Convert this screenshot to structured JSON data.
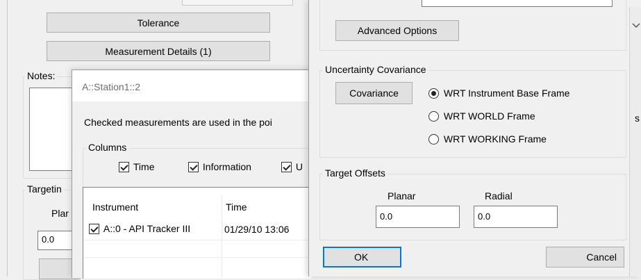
{
  "bg_panel": {
    "tolerance_label": "Tolerance",
    "measurement_details_label": "Measurement Details (1)",
    "notes_label": "Notes:",
    "targeting_label": "Targetin",
    "planar_label": "Plar",
    "planar_value": "0.0"
  },
  "mid_dialog": {
    "title": "A::Station1::2",
    "description": "Checked measurements are used in the poi",
    "columns_label": "Columns",
    "col_time": "Time",
    "col_information": "Information",
    "col_u": "U",
    "table_headers": [
      "Instrument",
      "Time"
    ],
    "rows": [
      {
        "instrument": "A::0 - API Tracker III",
        "time": "01/29/10 13:06",
        "checked": true
      }
    ]
  },
  "right_dialog": {
    "advanced_options_label": "Advanced Options",
    "uncertainty_label": "Uncertainty Covariance",
    "covariance_button": "Covariance",
    "radio_options": [
      {
        "label": "WRT Instrument Base Frame",
        "selected": true
      },
      {
        "label": "WRT WORLD Frame",
        "selected": false
      },
      {
        "label": "WRT WORKING Frame",
        "selected": false
      }
    ],
    "target_offsets_label": "Target Offsets",
    "planar_label": "Planar",
    "radial_label": "Radial",
    "planar_value": "0.0",
    "radial_value": "0.0",
    "ok_label": "OK",
    "cancel_label": "Cancel"
  },
  "edge_fragment": "s"
}
